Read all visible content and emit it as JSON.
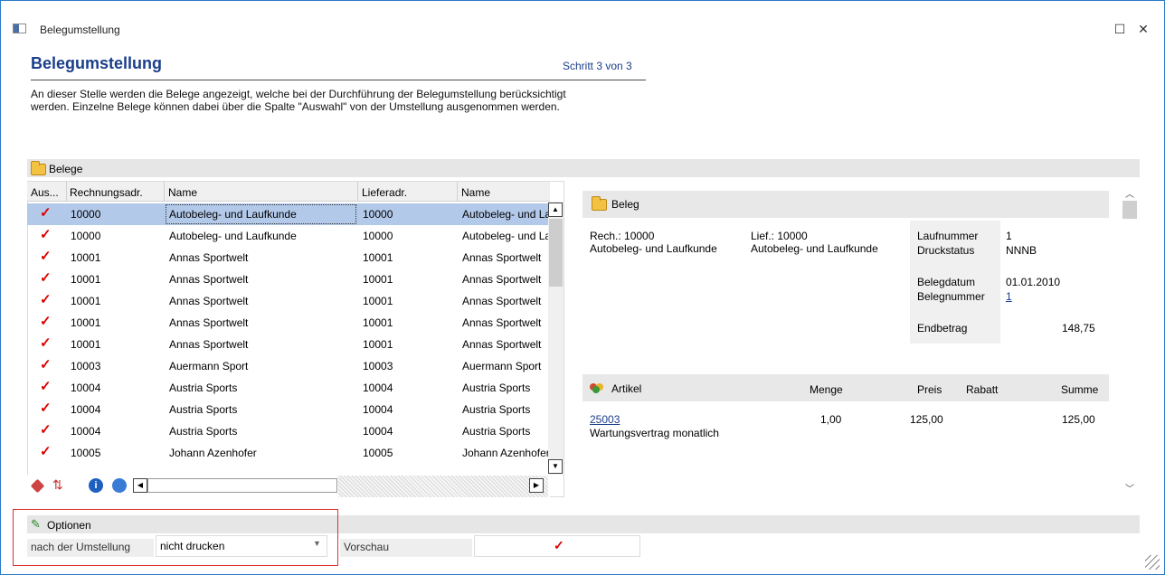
{
  "window": {
    "title": "Belegumstellung",
    "maximize_glyph": "☐",
    "close_glyph": "✕"
  },
  "header": {
    "title": "Belegumstellung",
    "step": "Schritt 3 von 3",
    "description_line1": "An dieser Stelle werden die Belege angezeigt, welche bei der Durchführung der Belegumstellung berücksichtigt",
    "description_line2": "werden. Einzelne Belege können dabei über die Spalte \"Auswahl\" von der Umstellung ausgenommen werden."
  },
  "belege": {
    "title": "Belege",
    "columns": [
      "Aus...",
      "Rechnungsadr.",
      "Name",
      "Lieferadr.",
      "Name"
    ],
    "rows": [
      {
        "checked": true,
        "rechnungsadr": "10000",
        "name": "Autobeleg- und Laufkunde",
        "lieferadr": "10000",
        "name2": "Autobeleg- und Laufkunde",
        "selected": true
      },
      {
        "checked": true,
        "rechnungsadr": "10000",
        "name": "Autobeleg- und Laufkunde",
        "lieferadr": "10000",
        "name2": "Autobeleg- und Laufkunde"
      },
      {
        "checked": true,
        "rechnungsadr": "10001",
        "name": "Annas Sportwelt",
        "lieferadr": "10001",
        "name2": "Annas Sportwelt"
      },
      {
        "checked": true,
        "rechnungsadr": "10001",
        "name": "Annas Sportwelt",
        "lieferadr": "10001",
        "name2": "Annas Sportwelt"
      },
      {
        "checked": true,
        "rechnungsadr": "10001",
        "name": "Annas Sportwelt",
        "lieferadr": "10001",
        "name2": "Annas Sportwelt"
      },
      {
        "checked": true,
        "rechnungsadr": "10001",
        "name": "Annas Sportwelt",
        "lieferadr": "10001",
        "name2": "Annas Sportwelt"
      },
      {
        "checked": true,
        "rechnungsadr": "10001",
        "name": "Annas Sportwelt",
        "lieferadr": "10001",
        "name2": "Annas Sportwelt"
      },
      {
        "checked": true,
        "rechnungsadr": "10003",
        "name": "Auermann Sport",
        "lieferadr": "10003",
        "name2": "Auermann Sport"
      },
      {
        "checked": true,
        "rechnungsadr": "10004",
        "name": "Austria Sports",
        "lieferadr": "10004",
        "name2": "Austria Sports"
      },
      {
        "checked": true,
        "rechnungsadr": "10004",
        "name": "Austria Sports",
        "lieferadr": "10004",
        "name2": "Austria Sports"
      },
      {
        "checked": true,
        "rechnungsadr": "10004",
        "name": "Austria Sports",
        "lieferadr": "10004",
        "name2": "Austria Sports"
      },
      {
        "checked": true,
        "rechnungsadr": "10005",
        "name": "Johann Azenhofer",
        "lieferadr": "10005",
        "name2": "Johann Azenhofer"
      }
    ]
  },
  "beleg": {
    "title": "Beleg",
    "rech": "Rech.: 10000",
    "rech_name": "Autobeleg- und Laufkunde",
    "lief": "Lief.: 10000",
    "lief_name": "Autobeleg- und Laufkunde",
    "laufnummer_label": "Laufnummer",
    "laufnummer": "1",
    "druckstatus_label": "Druckstatus",
    "druckstatus": "NNNB",
    "belegdatum_label": "Belegdatum",
    "belegdatum": "01.01.2010",
    "belegnummer_label": "Belegnummer",
    "belegnummer": "1",
    "endbetrag_label": "Endbetrag",
    "endbetrag": "148,75"
  },
  "artikel": {
    "title": "Artikel",
    "col_menge": "Menge",
    "col_preis": "Preis",
    "col_rabatt": "Rabatt",
    "col_summe": "Summe",
    "items": [
      {
        "nr": "25003",
        "text": "Wartungsvertrag monatlich",
        "menge": "1,00",
        "preis": "125,00",
        "summe": "125,00"
      }
    ]
  },
  "optionen": {
    "title": "Optionen",
    "nach_label": "nach der Umstellung",
    "nach_value": "nicht drucken",
    "vorschau_label": "Vorschau",
    "vorschau_checked": true
  }
}
